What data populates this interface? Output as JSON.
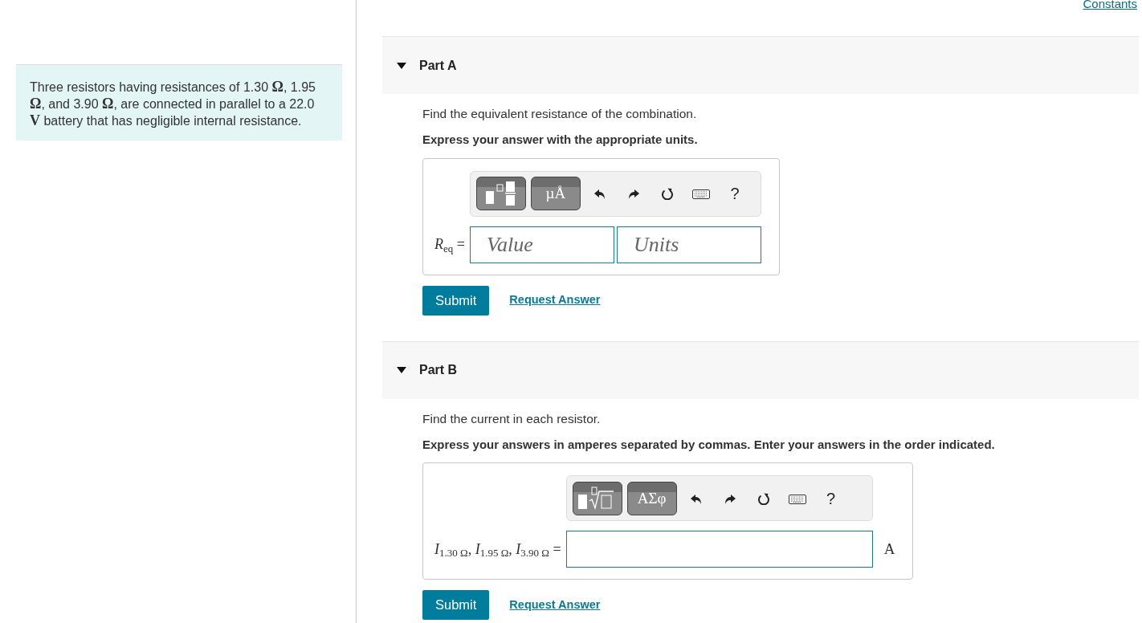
{
  "constants_link": "Constants",
  "problem": {
    "text": "Three resistors having resistances of 1.30 **Ω**, 1.95 **Ω**, and 3.90 **Ω**, are connected in parallel to a 22.0 **V** battery that has negligible internal resistance."
  },
  "parts": [
    {
      "title": "Part A",
      "expanded": true,
      "prompt": "Find the equivalent resistance of the combination.",
      "instruction": "Express your answer with the appropriate units.",
      "toolbar": [
        {
          "kind": "fraction"
        },
        {
          "kind": "symbols",
          "label": "µÅ"
        },
        {
          "kind": "undo"
        },
        {
          "kind": "redo"
        },
        {
          "kind": "reset"
        },
        {
          "kind": "keyboard"
        },
        {
          "kind": "help",
          "label": "?"
        }
      ],
      "label": "*R*$_{eq}$ =",
      "fields": [
        {
          "kind": "value",
          "placeholder": "Value"
        },
        {
          "kind": "units",
          "placeholder": "Units"
        }
      ],
      "buttons": [
        {
          "kind": "submit",
          "label": "Submit"
        },
        {
          "kind": "link",
          "label": "Request Answer"
        }
      ]
    },
    {
      "title": "Part B",
      "expanded": true,
      "prompt": "Find the current in each resistor.",
      "instruction": "Express your answers in amperes separated by commas. Enter your answers in the order indicated.",
      "toolbar": [
        {
          "kind": "root"
        },
        {
          "kind": "symbols",
          "label": "ΑΣφ"
        },
        {
          "kind": "undo"
        },
        {
          "kind": "redo"
        },
        {
          "kind": "reset"
        },
        {
          "kind": "keyboard"
        },
        {
          "kind": "help",
          "label": "?"
        }
      ],
      "label": "*I*$_{1.30 Ω}$, *I*$_{1.95 Ω}$, *I*$_{3.90 Ω}$ =",
      "fields": [
        {
          "kind": "answer"
        }
      ],
      "unit": "A",
      "buttons": [
        {
          "kind": "submit",
          "label": "Submit"
        },
        {
          "kind": "link",
          "label": "Request Answer"
        }
      ]
    }
  ]
}
